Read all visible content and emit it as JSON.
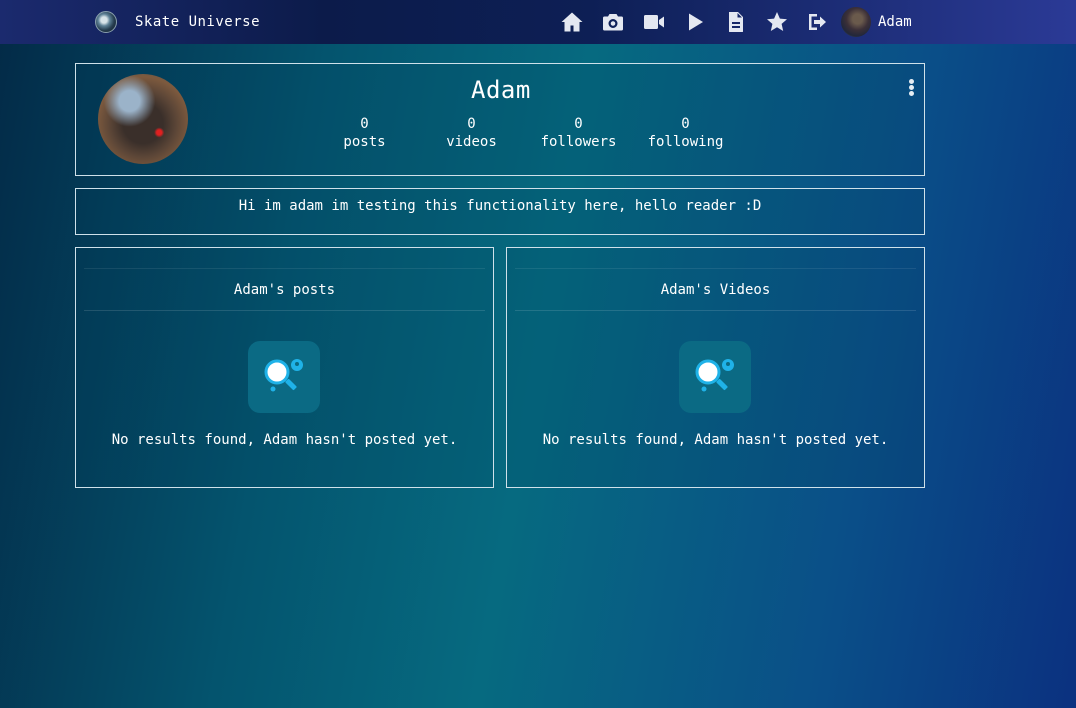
{
  "navbar": {
    "brand_name": "Skate Universe",
    "brand_logo_icon": "globe-logo",
    "icons": [
      "home-icon",
      "camera-icon",
      "video-icon",
      "play-icon",
      "file-icon",
      "star-icon",
      "logout-icon"
    ],
    "user_name": "Adam"
  },
  "profile": {
    "name": "Adam",
    "stats": [
      {
        "value": "0",
        "label": "posts"
      },
      {
        "value": "0",
        "label": "videos"
      },
      {
        "value": "0",
        "label": "followers"
      },
      {
        "value": "0",
        "label": "following"
      }
    ],
    "bio": "Hi im adam im testing this functionality here, hello reader :D"
  },
  "sections": {
    "posts": {
      "title": "Adam's posts",
      "empty_message": "No results found, Adam hasn't posted yet."
    },
    "videos": {
      "title": "Adam's Videos",
      "empty_message": "No results found, Adam hasn't posted yet."
    }
  },
  "colors": {
    "accent_icon": "#1fb2e8",
    "border": "#cfe1ea"
  }
}
